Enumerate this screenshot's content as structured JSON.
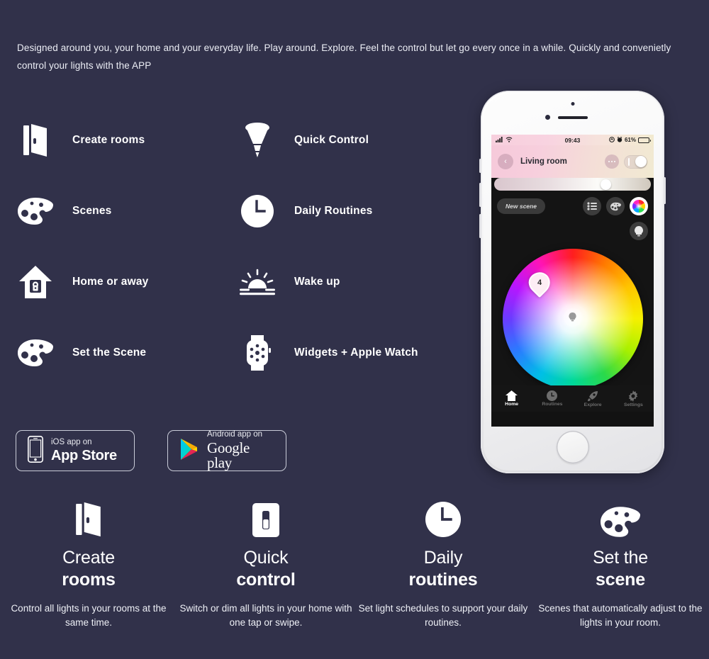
{
  "intro": {
    "paragraph": "Designed around you, your home and your everyday life. Play around. Explore. Feel the control but let go every once in a while. Quickly and convenietly control your lights with the  APP"
  },
  "features": {
    "left": [
      {
        "label": "Create rooms",
        "icon": "open-door-icon"
      },
      {
        "label": "Scenes",
        "icon": "paint-palette-icon"
      },
      {
        "label": "Home or away",
        "icon": "house-lock-icon"
      },
      {
        "label": "Set the Scene",
        "icon": "paint-palette-icon"
      }
    ],
    "right": [
      {
        "label": "Quick Control",
        "icon": "light-bulb-icon"
      },
      {
        "label": "Daily Routines",
        "icon": "clock-icon"
      },
      {
        "label": "Wake up",
        "icon": "sunrise-icon"
      },
      {
        "label": "Widgets + Apple Watch",
        "icon": "apple-watch-icon"
      }
    ]
  },
  "badges": {
    "ios": {
      "top": "iOS app on",
      "bottom": "App Store",
      "icon": "iphone-icon"
    },
    "android": {
      "top": "Android app on",
      "bottom": "Google play",
      "icon": "google-play-triangle-icon"
    }
  },
  "phone": {
    "statusbar": {
      "time": "09:43",
      "battery": "61%",
      "battery_level": 61,
      "signal": "signal-bars-icon",
      "wifi": "wifi-icon",
      "alarm": "alarm-icon",
      "rotation_lock": "rotation-lock-icon"
    },
    "header": {
      "back": "‹",
      "room": "Living room",
      "menu": "more-dots-icon",
      "toggle_state": "on",
      "brightness_percent": 68
    },
    "scene": {
      "new_scene_label": "New scene",
      "buttons": [
        {
          "name": "list-icon",
          "active": false
        },
        {
          "name": "palette-icon",
          "active": false
        },
        {
          "name": "color-wheel-icon",
          "active": true
        }
      ],
      "bulb_button": "bulb-icon",
      "wheel_pin_number": "4",
      "wheel_bulb_marker": "bulb-marker-icon"
    },
    "tabs": [
      {
        "label": "Home",
        "icon": "home-icon",
        "active": true
      },
      {
        "label": "Routines",
        "icon": "clock-icon",
        "active": false
      },
      {
        "label": "Explore",
        "icon": "rocket-icon",
        "active": false
      },
      {
        "label": "Settings",
        "icon": "gear-icon",
        "active": false
      }
    ]
  },
  "cards": [
    {
      "title_line1": "Create",
      "title_line2": "rooms",
      "desc": "Control all lights in your rooms at the same time.",
      "icon": "open-door-icon"
    },
    {
      "title_line1": "Quick",
      "title_line2": "control",
      "desc": "Switch or dim all lights in your home with one tap or swipe.",
      "icon": "light-switch-icon"
    },
    {
      "title_line1": "Daily",
      "title_line2": "routines",
      "desc": "Set light schedules to support your daily routines.",
      "icon": "clock-icon"
    },
    {
      "title_line1": "Set the",
      "title_line2": "scene",
      "desc": "Scenes that automatically adjust to the lights in your room.",
      "icon": "paint-palette-icon"
    }
  ],
  "colors": {
    "background": "#31314a",
    "text": "#ffffff",
    "phone_screen_dark": "#141414",
    "header_pink": "#f6c9da"
  }
}
